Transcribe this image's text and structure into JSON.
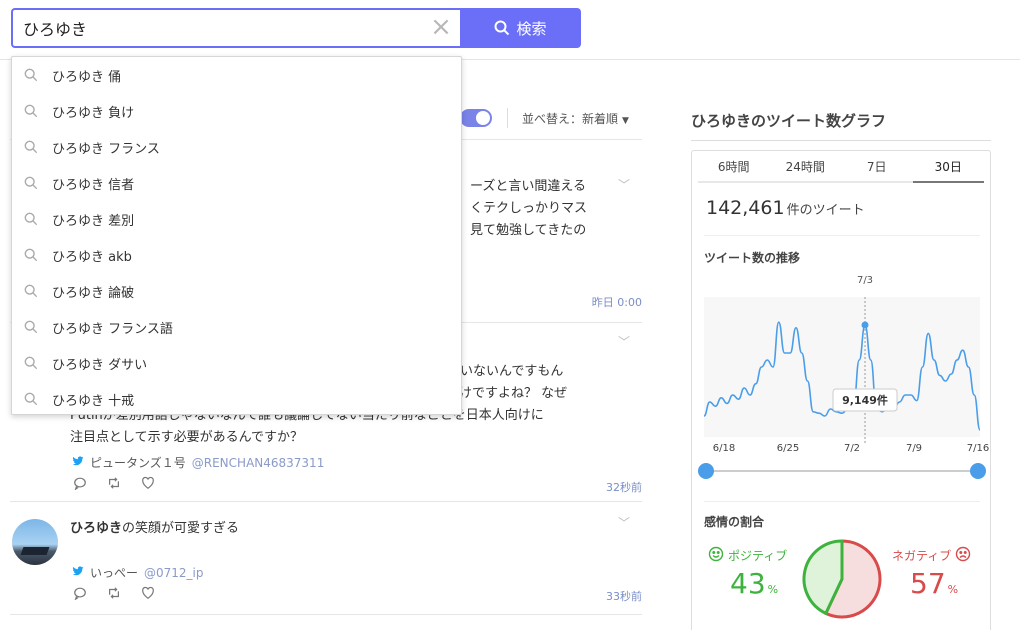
{
  "search": {
    "query": "ひろゆき",
    "clear_icon": "close-icon",
    "button_label": "検索"
  },
  "suggestions": [
    "ひろゆき 俑",
    "ひろゆき 負け",
    "ひろゆき フランス",
    "ひろゆき 信者",
    "ひろゆき 差別",
    "ひろゆき akb",
    "ひろゆき 論破",
    "ひろゆき フランス語",
    "ひろゆき ダサい",
    "ひろゆき 十戒"
  ],
  "feed": {
    "sort_label": "並べ替え：新着順",
    "tweets": [
      {
        "lines": [
          "ーズと言い間違える",
          "くテクしっかりマス",
          "見て勉強してきたの"
        ],
        "time": "昨日 0:00"
      },
      {
        "lines": [
          "いないんですもん",
          "だけですよね？ なぜ",
          "Putinが差別用語じゃないなんて誰も議論してない当たり前なことを日本人向けに",
          "注目点として示す必要があるんですか？"
        ],
        "author": "ピュータンズ１号",
        "handle": "@RENCHAN46837311",
        "time": "32秒前"
      },
      {
        "bold": "ひろゆき",
        "rest": "の笑顔が可愛すぎる",
        "author": "いっぺー",
        "handle": "@0712_ip",
        "time": "33秒前"
      }
    ]
  },
  "sidebar": {
    "title": "ひろゆきのツイート数グラフ",
    "tabs": [
      "6時間",
      "24時間",
      "7日",
      "30日"
    ],
    "active_tab": 3,
    "total_count": "142,461",
    "total_unit": "件のツイート",
    "trend_title": "ツイート数の推移",
    "sentiment_title": "感情の割合",
    "positive_label": "ポジティブ",
    "positive_pct": "43",
    "negative_label": "ネガティブ",
    "negative_pct": "57",
    "pct_unit": "%",
    "colors": {
      "positive": "#3db33d",
      "negative": "#d94a4a",
      "accent": "#6b6ff7",
      "line": "#4a9de8"
    }
  },
  "chart_data": {
    "type": "line",
    "x_ticks": [
      "6/18",
      "6/25",
      "7/2",
      "7/9",
      "7/16"
    ],
    "highlight": {
      "date": "7/3",
      "label": "9,149件"
    },
    "series": [
      {
        "values": [
          0.15,
          0.25,
          0.22,
          0.28,
          0.24,
          0.3,
          0.27,
          0.35,
          0.3,
          0.38,
          0.5,
          0.55,
          0.5,
          0.82,
          0.6,
          0.6,
          0.78,
          0.6,
          0.4,
          0.18,
          0.17,
          0.15,
          0.2,
          0.18,
          0.17,
          0.2,
          0.22,
          0.55,
          0.8,
          0.55,
          0.2,
          0.18,
          0.22,
          0.2,
          0.25,
          0.3,
          0.3,
          0.26,
          0.5,
          0.74,
          0.55,
          0.44,
          0.4,
          0.45,
          0.55,
          0.62,
          0.5,
          0.3,
          0.05
        ]
      }
    ],
    "positive_ratio": 0.43,
    "negative_ratio": 0.57
  }
}
